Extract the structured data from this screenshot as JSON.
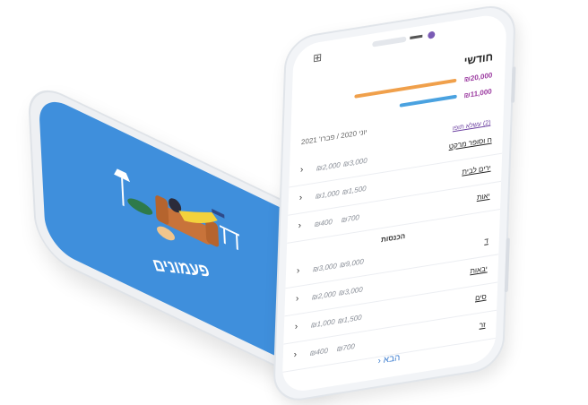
{
  "splash": {
    "app_name": "פעמונים",
    "background_color": "#3f8fdc"
  },
  "app": {
    "header_icons": [
      "grid-icon",
      "profile-dot-icon"
    ],
    "title": "חודשי",
    "bars": [
      {
        "amount": "₪20,000",
        "color": "#f0a04b",
        "fill": 0.82
      },
      {
        "amount": "₪11,000",
        "color": "#4aa2e0",
        "fill": 0.46
      }
    ],
    "date_range": "יוני 2020 / פברו' 2021",
    "expenses_chip": "(2) עשלא תופו",
    "expenses": [
      {
        "name": "ח וסופר מרקט",
        "v1": "₪3,000",
        "v2": "₪2,000"
      },
      {
        "name": "ירים לבית",
        "v1": "₪1,500",
        "v2": "₪1,000"
      },
      {
        "name": "יאות",
        "v1": "₪700",
        "v2": "₪400"
      }
    ],
    "income_section": "הכנסות",
    "income": [
      {
        "name": "ד",
        "v1": "₪9,000",
        "v2": "₪3,000"
      },
      {
        "name": "יבאות",
        "v1": "₪3,000",
        "v2": "₪2,000"
      },
      {
        "name": "סים",
        "v1": "₪1,500",
        "v2": "₪1,000"
      },
      {
        "name": "זר",
        "v1": "₪700",
        "v2": "₪400"
      }
    ],
    "next_label": "הבא"
  },
  "colors": {
    "accent": "#3f7fd0",
    "purple": "#7a5bb5",
    "orange": "#f0a04b",
    "blue": "#4aa2e0"
  }
}
